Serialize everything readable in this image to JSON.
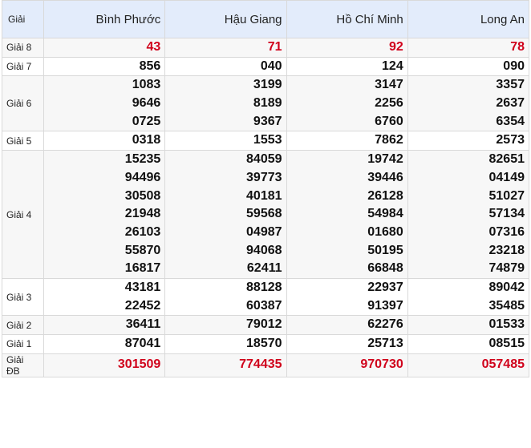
{
  "header": {
    "prize_col": "Giải",
    "provinces": [
      "Bình Phước",
      "Hậu Giang",
      "Hồ Chí Minh",
      "Long An"
    ]
  },
  "rows": [
    {
      "name": "Giải 8",
      "red": true,
      "values": [
        [
          "43"
        ],
        [
          "71"
        ],
        [
          "92"
        ],
        [
          "78"
        ]
      ]
    },
    {
      "name": "Giải 7",
      "red": false,
      "values": [
        [
          "856"
        ],
        [
          "040"
        ],
        [
          "124"
        ],
        [
          "090"
        ]
      ]
    },
    {
      "name": "Giải 6",
      "red": false,
      "values": [
        [
          "1083",
          "9646",
          "0725"
        ],
        [
          "3199",
          "8189",
          "9367"
        ],
        [
          "3147",
          "2256",
          "6760"
        ],
        [
          "3357",
          "2637",
          "6354"
        ]
      ]
    },
    {
      "name": "Giải 5",
      "red": false,
      "values": [
        [
          "0318"
        ],
        [
          "1553"
        ],
        [
          "7862"
        ],
        [
          "2573"
        ]
      ]
    },
    {
      "name": "Giải 4",
      "red": false,
      "values": [
        [
          "15235",
          "94496",
          "30508",
          "21948",
          "26103",
          "55870",
          "16817"
        ],
        [
          "84059",
          "39773",
          "40181",
          "59568",
          "04987",
          "94068",
          "62411"
        ],
        [
          "19742",
          "39446",
          "26128",
          "54984",
          "01680",
          "50195",
          "66848"
        ],
        [
          "82651",
          "04149",
          "51027",
          "57134",
          "07316",
          "23218",
          "74879"
        ]
      ]
    },
    {
      "name": "Giải 3",
      "red": false,
      "values": [
        [
          "43181",
          "22452"
        ],
        [
          "88128",
          "60387"
        ],
        [
          "22937",
          "91397"
        ],
        [
          "89042",
          "35485"
        ]
      ]
    },
    {
      "name": "Giải 2",
      "red": false,
      "values": [
        [
          "36411"
        ],
        [
          "79012"
        ],
        [
          "62276"
        ],
        [
          "01533"
        ]
      ]
    },
    {
      "name": "Giải 1",
      "red": false,
      "values": [
        [
          "87041"
        ],
        [
          "18570"
        ],
        [
          "25713"
        ],
        [
          "08515"
        ]
      ]
    },
    {
      "name": "Giải ĐB",
      "red": true,
      "values": [
        [
          "301509"
        ],
        [
          "774435"
        ],
        [
          "970730"
        ],
        [
          "057485"
        ]
      ]
    }
  ]
}
